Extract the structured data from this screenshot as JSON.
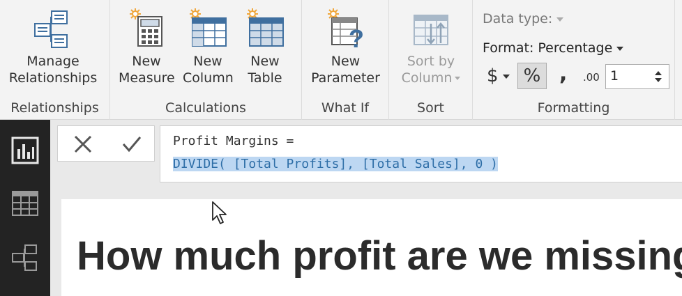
{
  "ribbon": {
    "groups": {
      "relationships": {
        "label": "Relationships",
        "manage": {
          "line1": "Manage",
          "line2": "Relationships",
          "icon": "manage-relationships-icon"
        }
      },
      "calculations": {
        "label": "Calculations",
        "new_measure": {
          "line1": "New",
          "line2": "Measure",
          "icon": "calculator-icon"
        },
        "new_column": {
          "line1": "New",
          "line2": "Column",
          "icon": "column-table-icon"
        },
        "new_table": {
          "line1": "New",
          "line2": "Table",
          "icon": "table-icon"
        }
      },
      "whatif": {
        "label": "What If",
        "new_parameter": {
          "line1": "New",
          "line2": "Parameter",
          "icon": "parameter-icon"
        }
      },
      "sort": {
        "label": "Sort",
        "sort_by_column": {
          "line1": "Sort by",
          "line2": "Column",
          "icon": "sort-icon",
          "enabled": false
        }
      },
      "formatting": {
        "label": "Formatting",
        "data_type_label": "Data type:",
        "format_label": "Format: Percentage",
        "currency_symbol": "$",
        "percent_symbol": "%",
        "comma_symbol": ",",
        "decimal_icon": ".00",
        "decimal_places": "1"
      }
    }
  },
  "formula_bar": {
    "cancel_icon": "close-icon",
    "commit_icon": "check-icon",
    "line1": "Profit Margins =",
    "line2": "DIVIDE( [Total Profits], [Total Sales], 0 )"
  },
  "left_nav": {
    "items": [
      {
        "name": "report-view",
        "icon": "bar-chart-icon"
      },
      {
        "name": "data-view",
        "icon": "grid-icon"
      },
      {
        "name": "relationships-view",
        "icon": "relationships-icon"
      }
    ]
  },
  "canvas": {
    "headline": "How much profit are we missing"
  },
  "colors": {
    "ribbon_bg": "#f3f3f3",
    "nav_bg": "#232323",
    "selection": "#bdd7f2",
    "selection_text": "#2e6ea7",
    "icon_blue": "#3f6f9f",
    "sparkle": "#f0a73c"
  }
}
